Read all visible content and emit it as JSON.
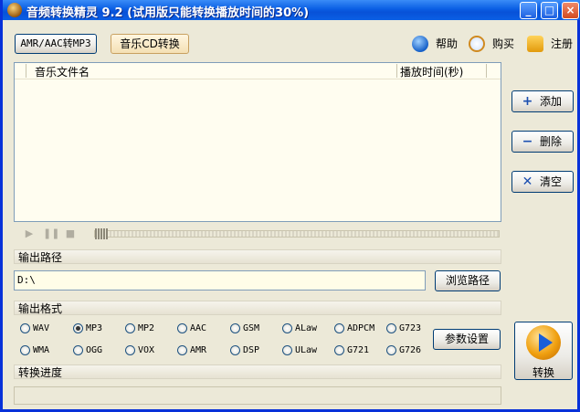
{
  "window": {
    "title": "音频转换精灵 9.2 (试用版只能转换播放时间的30%)"
  },
  "titlebar_buttons": {
    "minimize": "_",
    "maximize": "□",
    "close": "×"
  },
  "tabs": {
    "amr_to_mp3": "AMR/AAC转MP3",
    "cd_convert": "音乐CD转换"
  },
  "top_links": {
    "help": "帮助",
    "buy": "购买",
    "register": "注册"
  },
  "file_list": {
    "columns": [
      "音乐文件名",
      "播放时间(秒)"
    ],
    "rows": []
  },
  "side_buttons": {
    "add": "添加",
    "delete": "删除",
    "clear": "清空"
  },
  "player": {
    "play": "▶",
    "pause": "❚❚",
    "stop": "■"
  },
  "output_path": {
    "section_label": "输出路径",
    "value": "D:\\",
    "browse_label": "浏览路径"
  },
  "output_format": {
    "section_label": "输出格式",
    "options": [
      "WAV",
      "MP3",
      "MP2",
      "AAC",
      "GSM",
      "ALaw",
      "ADPCM",
      "G723",
      "WMA",
      "OGG",
      "VOX",
      "AMR",
      "DSP",
      "ULaw",
      "G721",
      "G726"
    ],
    "selected": "MP3",
    "params_label": "参数设置"
  },
  "convert": {
    "label": "转换"
  },
  "progress": {
    "section_label": "转换进度",
    "fraction": 0
  }
}
